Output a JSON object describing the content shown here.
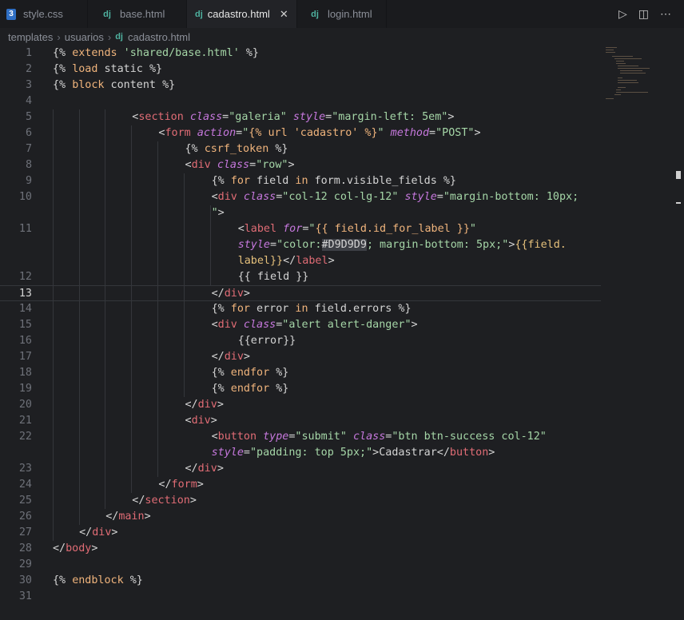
{
  "tabs": [
    {
      "label": "style.css",
      "icon": "css-icon",
      "icon_glyph": "3",
      "active": false
    },
    {
      "label": "base.html",
      "icon": "django-icon",
      "icon_glyph": "dj",
      "active": false
    },
    {
      "label": "cadastro.html",
      "icon": "django-icon",
      "icon_glyph": "dj",
      "active": true
    },
    {
      "label": "login.html",
      "icon": "django-icon",
      "icon_glyph": "dj",
      "active": false
    }
  ],
  "tab_close_glyph": "✕",
  "actions": {
    "run_glyph": "▷",
    "split_glyph": "◫",
    "more_glyph": "⋯"
  },
  "breadcrumb": {
    "folder1": "templates",
    "folder2": "usuarios",
    "file_icon": "dj",
    "file": "cadastro.html",
    "sep": "›"
  },
  "editor": {
    "current_line": 13,
    "lines": [
      {
        "n": "1"
      },
      {
        "n": "2"
      },
      {
        "n": "3"
      },
      {
        "n": "4"
      },
      {
        "n": "5"
      },
      {
        "n": "6"
      },
      {
        "n": "7"
      },
      {
        "n": "8"
      },
      {
        "n": "9"
      },
      {
        "n": "10"
      },
      {
        "n": ""
      },
      {
        "n": "11"
      },
      {
        "n": ""
      },
      {
        "n": ""
      },
      {
        "n": "12"
      },
      {
        "n": "13"
      },
      {
        "n": "14"
      },
      {
        "n": "15"
      },
      {
        "n": "16"
      },
      {
        "n": "17"
      },
      {
        "n": "18"
      },
      {
        "n": "19"
      },
      {
        "n": "20"
      },
      {
        "n": "21"
      },
      {
        "n": "22"
      },
      {
        "n": ""
      },
      {
        "n": "23"
      },
      {
        "n": "24"
      },
      {
        "n": "25"
      },
      {
        "n": "26"
      },
      {
        "n": "27"
      },
      {
        "n": "28"
      },
      {
        "n": "29"
      },
      {
        "n": "30"
      },
      {
        "n": "31"
      }
    ]
  },
  "code": {
    "l1": [
      "{% ",
      "extends",
      " 'shared/base.html' ",
      "%}"
    ],
    "l2": [
      "{% ",
      "load",
      " static ",
      "%}"
    ],
    "l3": [
      "{% ",
      "block",
      " content ",
      "%}"
    ],
    "l5": [
      "<",
      "section",
      " ",
      "class",
      "=",
      "\"galeria\"",
      " ",
      "style",
      "=",
      "\"margin-left: 5em\"",
      ">"
    ],
    "l6": [
      "<",
      "form",
      " ",
      "action",
      "=",
      "\"",
      "{% url 'cadastro' %}",
      "\"",
      " ",
      "method",
      "=",
      "\"POST\"",
      ">"
    ],
    "l7": [
      "{% ",
      "csrf_token",
      " %}"
    ],
    "l8": [
      "<",
      "div",
      " ",
      "class",
      "=",
      "\"row\"",
      ">"
    ],
    "l9": [
      "{% ",
      "for",
      " field ",
      "in",
      " form.visible_fields ",
      "%}"
    ],
    "l10a": [
      "<",
      "div",
      " ",
      "class",
      "=",
      "\"col-12 col-lg-12\"",
      " ",
      "style",
      "=",
      "\"margin-bottom: 10px;"
    ],
    "l10b": [
      "\"",
      ">"
    ],
    "l11a": [
      "<",
      "label",
      " ",
      "for",
      "=",
      "\"",
      "{{ field.id_for_label }}",
      "\""
    ],
    "l11b": [
      "style",
      "=",
      "\"color:",
      "#D9D9D9",
      "; margin-bottom: 5px;\"",
      ">",
      "{{field.",
      "label}}",
      "</",
      "label",
      ">"
    ],
    "l12": [
      "{{ field }}"
    ],
    "l13": [
      "</",
      "div",
      ">"
    ],
    "l14": [
      "{% ",
      "for",
      " error ",
      "in",
      " field.errors ",
      "%}"
    ],
    "l15": [
      "<",
      "div",
      " ",
      "class",
      "=",
      "\"alert alert-danger\"",
      ">"
    ],
    "l16": [
      "{{error}}"
    ],
    "l17": [
      "</",
      "div",
      ">"
    ],
    "l18": [
      "{% ",
      "endfor",
      " %}"
    ],
    "l19": [
      "{% ",
      "endfor",
      " %}"
    ],
    "l20": [
      "</",
      "div",
      ">"
    ],
    "l21": [
      "<",
      "div",
      ">"
    ],
    "l22a": [
      "<",
      "button",
      " ",
      "type",
      "=",
      "\"submit\"",
      " ",
      "class",
      "=",
      "\"btn btn-success col-12\""
    ],
    "l22b": [
      "style",
      "=",
      "\"padding: top 5px;\"",
      ">",
      "Cadastrar",
      "</",
      "button",
      ">"
    ],
    "l23": [
      "</",
      "div",
      ">"
    ],
    "l24": [
      "</",
      "form",
      ">"
    ],
    "l25": [
      "</",
      "section",
      ">"
    ],
    "l26": [
      "</",
      "main",
      ">"
    ],
    "l27": [
      "</",
      "div",
      ">"
    ],
    "l28": [
      "</",
      "body",
      ">"
    ],
    "l30": [
      "{% ",
      "endblock",
      " %}"
    ]
  }
}
